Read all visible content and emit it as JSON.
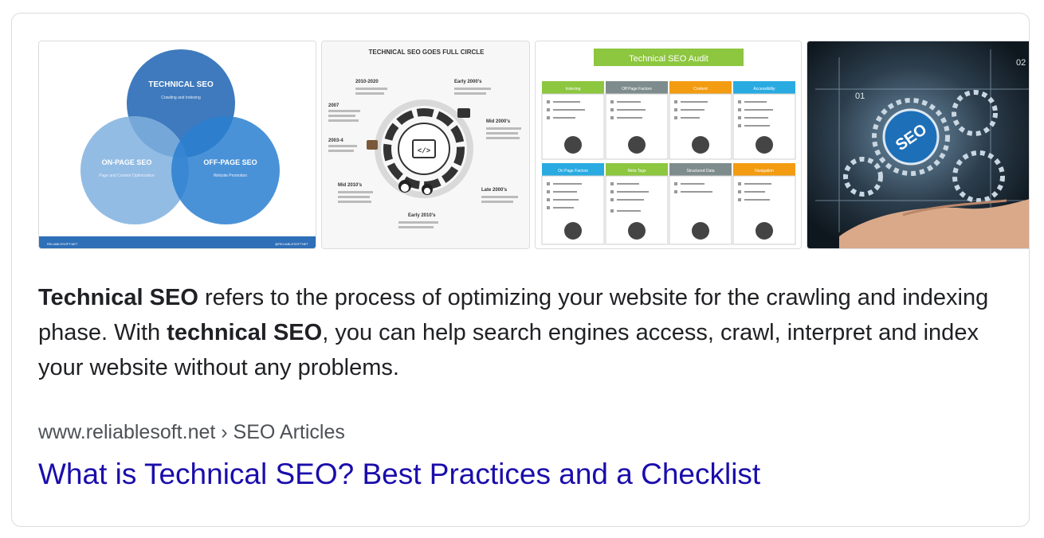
{
  "images": {
    "venn": {
      "circles": [
        {
          "title": "TECHNICAL SEO",
          "sub": "Crawling and Indexing"
        },
        {
          "title": "ON-PAGE SEO",
          "sub": "Page and Content Optimization"
        },
        {
          "title": "OFF-PAGE SEO",
          "sub": "Website Promotion"
        }
      ],
      "footer_left": "RELIABLESOFT.NET",
      "footer_right": "@RELIABLESOFTNET"
    },
    "circle": {
      "title": "TECHNICAL SEO GOES FULL CIRCLE",
      "labels": [
        "2010-2020",
        "Early 2000's",
        "2007",
        "Mid 2000's",
        "2003-4",
        "Mid 2010's",
        "Late 2000's",
        "Early 2010's"
      ],
      "center": "</>"
    },
    "audit": {
      "title": "Technical SEO Audit",
      "top_headers": [
        "Indexing",
        "Off Page Factors",
        "Content",
        "Accessibility"
      ],
      "bottom_headers": [
        "On Page Factors",
        "Meta Tags",
        "Structured Data",
        "Navigation"
      ],
      "colors": {
        "title": "#8dc63f",
        "green": "#8dc63f",
        "gray": "#7f8c8d",
        "orange": "#f39c12",
        "blue": "#29abe2"
      }
    },
    "hand": {
      "badge": "SEO",
      "numbers": [
        "01",
        "02"
      ]
    }
  },
  "snippet": {
    "b1": "Technical SEO",
    "t1": " refers to the process of optimizing your website for the crawling and indexing phase. With ",
    "b2": "technical SEO",
    "t2": ", you can help search engines access, crawl, interpret and index your website without any problems."
  },
  "result": {
    "cite": "www.reliablesoft.net › SEO Articles",
    "title": "What is Technical SEO? Best Practices and a Checklist"
  }
}
